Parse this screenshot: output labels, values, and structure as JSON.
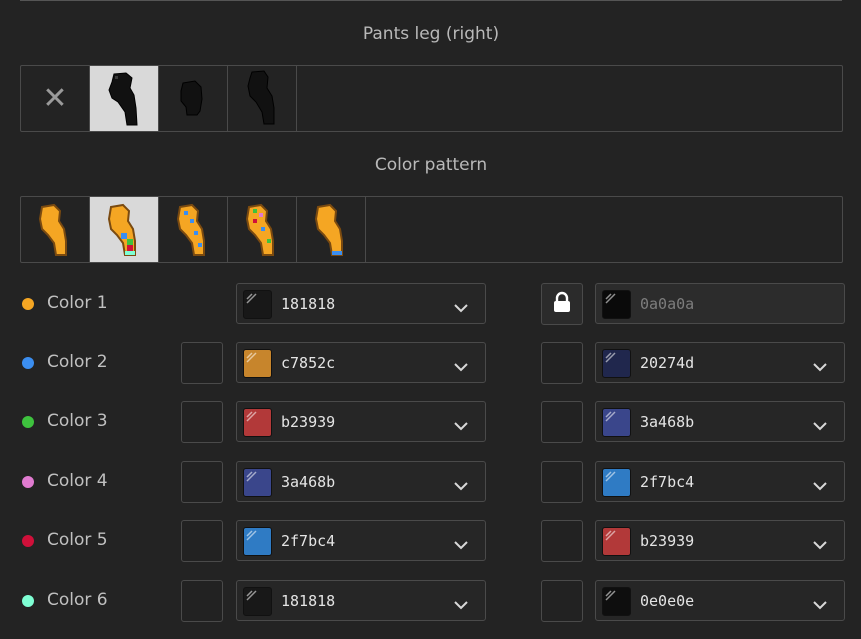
{
  "sections": {
    "pants_title": "Pants leg (right)",
    "pattern_title": "Color pattern"
  },
  "pants_options": [
    {
      "name": "none",
      "icon": "close-icon",
      "selected": false
    },
    {
      "name": "leg-style-1",
      "icon": "pants-leg-sprite-icon",
      "selected": true
    },
    {
      "name": "leg-style-2",
      "icon": "pants-leg-sprite-icon",
      "selected": false
    },
    {
      "name": "leg-style-3",
      "icon": "pants-leg-sprite-icon",
      "selected": false
    }
  ],
  "pattern_options": [
    {
      "name": "pattern-1",
      "icon": "color-pattern-sprite-icon",
      "selected": false
    },
    {
      "name": "pattern-2",
      "icon": "color-pattern-sprite-icon",
      "selected": true
    },
    {
      "name": "pattern-3",
      "icon": "color-pattern-sprite-icon",
      "selected": false
    },
    {
      "name": "pattern-4",
      "icon": "color-pattern-sprite-icon",
      "selected": false
    },
    {
      "name": "pattern-5",
      "icon": "color-pattern-sprite-icon",
      "selected": false
    }
  ],
  "colors": [
    {
      "label": "Color 1",
      "dot": "#f5a623",
      "primary": {
        "value": "181818",
        "swatch": "#181818"
      },
      "secondary": {
        "value": "0a0a0a",
        "swatch": "#0a0a0a",
        "locked": true
      }
    },
    {
      "label": "Color 2",
      "dot": "#3b8ef0",
      "primary": {
        "value": "c7852c",
        "swatch": "#c7852c"
      },
      "secondary": {
        "value": "20274d",
        "swatch": "#20274d",
        "locked": false
      }
    },
    {
      "label": "Color 3",
      "dot": "#3ec23e",
      "primary": {
        "value": "b23939",
        "swatch": "#b23939"
      },
      "secondary": {
        "value": "3a468b",
        "swatch": "#3a468b",
        "locked": false
      }
    },
    {
      "label": "Color 4",
      "dot": "#e07bd0",
      "primary": {
        "value": "3a468b",
        "swatch": "#3a468b"
      },
      "secondary": {
        "value": "2f7bc4",
        "swatch": "#2f7bc4",
        "locked": false
      }
    },
    {
      "label": "Color 5",
      "dot": "#d0103a",
      "primary": {
        "value": "2f7bc4",
        "swatch": "#2f7bc4"
      },
      "secondary": {
        "value": "b23939",
        "swatch": "#b23939",
        "locked": false
      }
    },
    {
      "label": "Color 6",
      "dot": "#7fffd4",
      "primary": {
        "value": "181818",
        "swatch": "#181818"
      },
      "secondary": {
        "value": "0e0e0e",
        "swatch": "#0e0e0e",
        "locked": false
      }
    }
  ]
}
